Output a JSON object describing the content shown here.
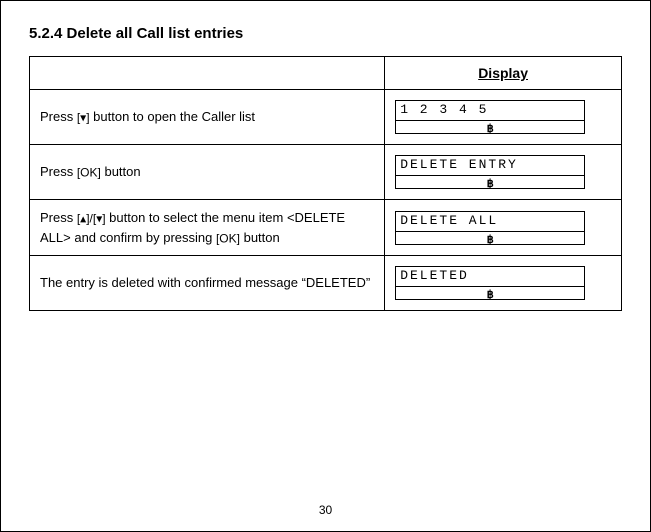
{
  "page_number": "30",
  "heading": "5.2.4  Delete all Call list entries",
  "columns": {
    "display_header": "Display"
  },
  "buttons": {
    "down": "[▾]",
    "up_down": "[▴]/[▾]",
    "ok": "[OK]"
  },
  "steps": [
    {
      "instruction_pre": "Press ",
      "instruction_btn": "down",
      "instruction_post": " button to open the Caller list",
      "display_line1": "1 2 3 4 5"
    },
    {
      "instruction_pre": "Press ",
      "instruction_btn": "ok",
      "instruction_post": " button",
      "display_line1": "DELETE  ENTRY"
    },
    {
      "instruction_pre": "Press ",
      "instruction_btn": "up_down",
      "instruction_mid": " button to select the menu item <DELETE ALL> and confirm by pressing   ",
      "instruction_btn2": "ok",
      "instruction_post": " button",
      "display_line1": "DELETE  ALL"
    },
    {
      "instruction_plain": "The entry is deleted  with confirmed message “DELETED”",
      "display_line1": "DELETED"
    }
  ],
  "icons": {
    "bluetooth_glyph": "฿"
  }
}
